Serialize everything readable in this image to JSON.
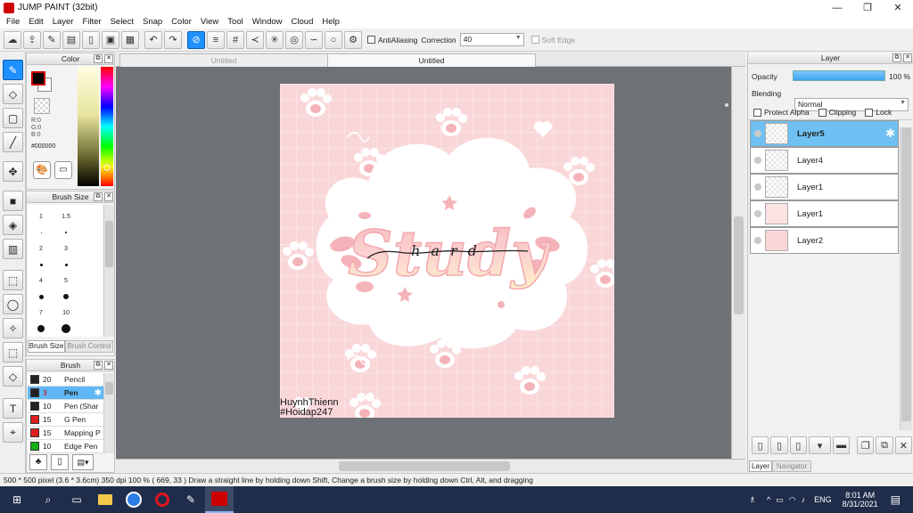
{
  "window": {
    "title": "JUMP PAINT (32bit)",
    "min": "—",
    "max": "❐",
    "close": "✕"
  },
  "menu": [
    "File",
    "Edit",
    "Layer",
    "Filter",
    "Select",
    "Snap",
    "Color",
    "View",
    "Tool",
    "Window",
    "Cloud",
    "Help"
  ],
  "toolbar": {
    "antialias_label": "AntiAliasing",
    "correction_label": "Correction",
    "correction_value": "40",
    "softedge_label": "Soft Edge"
  },
  "color_panel": {
    "title": "Color",
    "r": "R:0",
    "g": "G:0",
    "b": "B:0",
    "hex": "#000000",
    "foreground": "#000000",
    "background": "#ffffff"
  },
  "brush_size_panel": {
    "title": "Brush Size",
    "sizes": [
      "1",
      "1.5",
      "2",
      "3",
      "4",
      "5",
      "7",
      "10",
      "12",
      "15"
    ],
    "tab_active": "Brush Size",
    "tab_inactive": "Brush Control"
  },
  "brush_panel": {
    "title": "Brush",
    "items": [
      {
        "size": "20",
        "name": "Pencil",
        "color": "#222222"
      },
      {
        "size": "3",
        "name": "Pen",
        "color": "#222222"
      },
      {
        "size": "10",
        "name": "Pen (Shar",
        "color": "#222222"
      },
      {
        "size": "15",
        "name": "G Pen",
        "color": "#e02020"
      },
      {
        "size": "15",
        "name": "Mapping P",
        "color": "#e02020"
      },
      {
        "size": "10",
        "name": "Edge Pen",
        "color": "#18b018"
      }
    ]
  },
  "canvas_tabs": [
    "Untitled",
    "Untitled"
  ],
  "artwork": {
    "word": "Study",
    "script": "hard",
    "credit_name": "HuynhThienn",
    "credit_tag": "#Hoidap247",
    "bg_color": "#f9d7d9",
    "cloud_color": "#ffffff",
    "accent_color": "#f4b3b8"
  },
  "layer_panel": {
    "title": "Layer",
    "opacity_label": "Opacity",
    "opacity_value": "100 %",
    "opacity_fraction": 1.0,
    "blending_label": "Blending",
    "blending_value": "Normal",
    "protect_alpha": "Protect Alpha",
    "clipping": "Clipping",
    "lock": "Lock",
    "layers": [
      "Layer5",
      "Layer4",
      "Layer1",
      "Layer1",
      "Layer2"
    ],
    "bottom_tab_active": "Layer",
    "bottom_tab_inactive": "Navigator"
  },
  "status": {
    "text": "500 * 500 pixel   (3.6 * 3.6cm)   350 dpi   100 %   ( 669, 33 )   Draw a straight line by holding down Shift, Change a brush size by holding down Ctrl, Alt, and dragging"
  },
  "taskbar": {
    "lang": "ENG",
    "time": "8:01 AM",
    "date": "8/31/2021"
  }
}
